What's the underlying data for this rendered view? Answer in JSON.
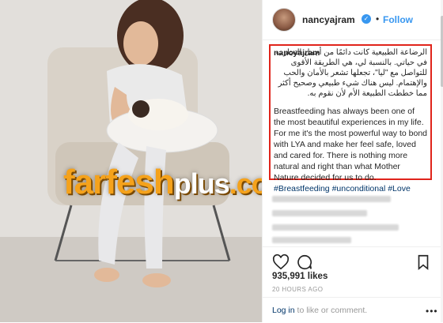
{
  "photo": {
    "alt_icon": "photo-mother-baby"
  },
  "watermark": {
    "main": "farfesh",
    "plus": "plus",
    "dotcom": ".com"
  },
  "header": {
    "username": "nancyajram",
    "separator": "•",
    "follow_label": "Follow",
    "verified_glyph": "✓"
  },
  "caption": {
    "username": "nancyajram",
    "arabic": "الرضاعة الطبيعية كانت دائمًا من أجمل التجارب في حياتي. بالنسبة لي، هي الطريقة الأقوى للتواصل مع \"ليا\"، تجعلها تشعر بالأمان والحب والإهتمام. ليس هناك شيء طبيعي وصحيح أكثر مما خططت الطبيعة الأم لأن نقوم به.",
    "english_text": "Breastfeeding has always been one of the most beautiful experiences in my life. For me it's the most powerful way to bond with LYA and make her feel safe, loved and cared for. There is nothing more natural and right than what Mother Nature decided for us to do.",
    "hashtags": [
      "#Breastfeeding",
      "#unconditional",
      "#Love"
    ]
  },
  "actions": {
    "like_icon": "heart-icon",
    "comment_icon": "comment-icon",
    "save_icon": "bookmark-icon"
  },
  "likes": "935,991 likes",
  "timestamp": "20 HOURS AGO",
  "login": {
    "link": "Log in",
    "rest": " to like or comment.",
    "more": "•••"
  },
  "colors": {
    "accent": "#3897f0",
    "highlight_border": "#e0241b",
    "hashtag": "#003569"
  }
}
